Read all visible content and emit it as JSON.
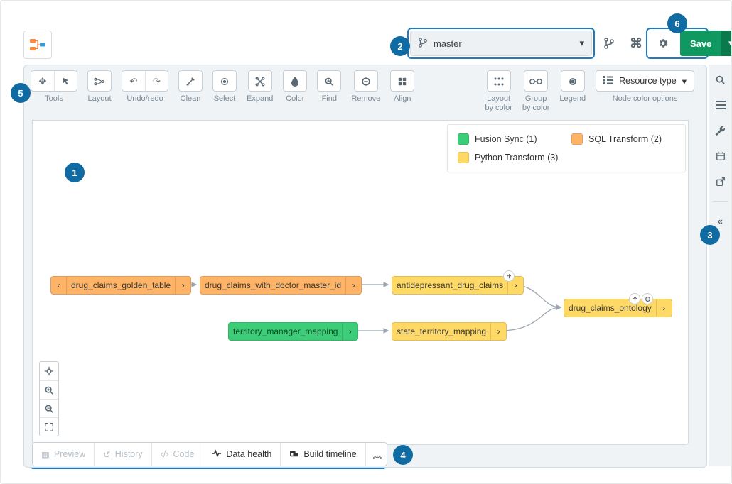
{
  "header": {
    "branch": "master",
    "save_label": "Save"
  },
  "toolbar": {
    "tools": "Tools",
    "layout": "Layout",
    "undoredo": "Undo/redo",
    "clean": "Clean",
    "select": "Select",
    "expand": "Expand",
    "color": "Color",
    "find": "Find",
    "remove": "Remove",
    "align": "Align",
    "layout_by_color": "Layout\nby color",
    "group_by_color": "Group\nby color",
    "legend": "Legend",
    "resource_type": "Resource type",
    "node_color_options": "Node color options"
  },
  "legend": {
    "items": [
      {
        "label": "Fusion Sync (1)",
        "color": "#3dcc77"
      },
      {
        "label": "SQL Transform (2)",
        "color": "#ffb366"
      },
      {
        "label": "Python Transform (3)",
        "color": "#ffd966"
      }
    ]
  },
  "nodes": {
    "n1": "drug_claims_golden_table",
    "n2": "drug_claims_with_doctor_master_id",
    "n3": "antidepressant_drug_claims",
    "n4": "territory_manager_mapping",
    "n5": "state_territory_mapping",
    "n6": "drug_claims_ontology"
  },
  "bottom_tabs": {
    "preview": "Preview",
    "history": "History",
    "code": "Code",
    "data_health": "Data health",
    "build_timeline": "Build timeline"
  },
  "callouts": {
    "c1": "1",
    "c2": "2",
    "c3": "3",
    "c4": "4",
    "c5": "5",
    "c6": "6"
  }
}
